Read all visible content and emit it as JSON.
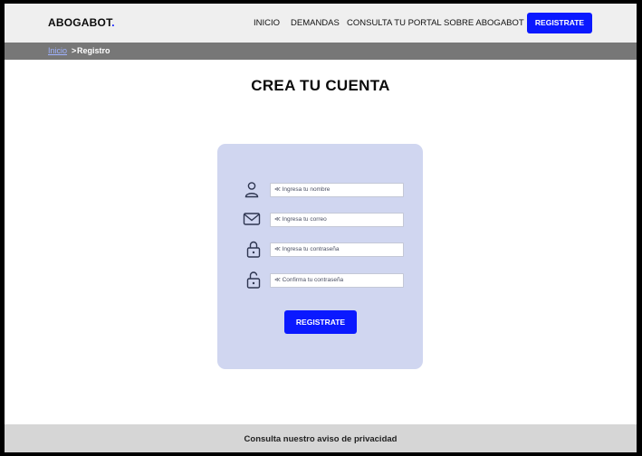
{
  "header": {
    "logo": "ABOGABOT",
    "logo_dot": ".",
    "nav": [
      "INICIO",
      "DEMANDAS",
      "CONSULTA TU PORTAL",
      "SOBRE ABOGABOT"
    ],
    "cta_label": "REGISTRATE"
  },
  "breadcrumb": {
    "home": "Inicio",
    "separator": ">",
    "current": "Registro"
  },
  "main": {
    "title": "CREA TU CUENTA"
  },
  "form": {
    "fields": [
      {
        "icon": "user-icon",
        "placeholder": "≪ Ingresa tu nombre"
      },
      {
        "icon": "mail-icon",
        "placeholder": "≪ Ingresa tu correo"
      },
      {
        "icon": "lock-icon",
        "placeholder": "≪ Ingresa tu contraseña"
      },
      {
        "icon": "unlock-icon",
        "placeholder": "≪ Confirma tu contraseña"
      }
    ],
    "submit_label": "REGISTRATE"
  },
  "footer": {
    "text": "Consulta nuestro aviso de privacidad"
  },
  "colors": {
    "accent": "#0a19ff",
    "card": "#d0d6f0",
    "breadcrumb_bar": "#777777",
    "header_bg": "#efefef",
    "footer_bg": "#d6d6d6"
  }
}
